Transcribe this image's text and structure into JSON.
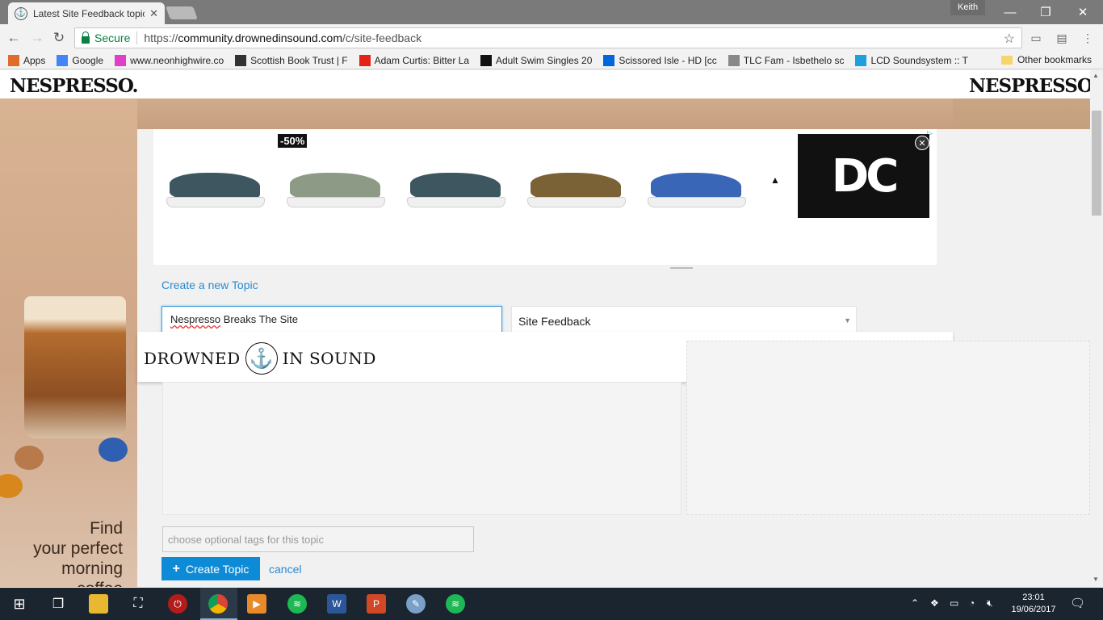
{
  "browser": {
    "tab_title": "Latest Site Feedback topics",
    "profile": "Keith",
    "secure_label": "Secure",
    "url_scheme": "https://",
    "url_host": "community.drownedinsound.com",
    "url_path": "/c/site-feedback"
  },
  "bookmarks": [
    {
      "label": "Apps",
      "icon": "apps-grid-icon",
      "color": "#e06b2b"
    },
    {
      "label": "Google",
      "icon": "google-icon",
      "color": "#4285f4"
    },
    {
      "label": "www.neonhighwire.co",
      "icon": "neonhighwire-icon",
      "color": "#e040c8"
    },
    {
      "label": "Scottish Book Trust | F",
      "icon": "book-trust-icon",
      "color": "#333333"
    },
    {
      "label": "Adam Curtis: Bitter La",
      "icon": "youtube-icon",
      "color": "#e62117"
    },
    {
      "label": "Adult Swim Singles 20",
      "icon": "adult-swim-icon",
      "color": "#111111"
    },
    {
      "label": "Scissored Isle - HD [cc",
      "icon": "dailymotion-icon",
      "color": "#0066dc"
    },
    {
      "label": "TLC Fam - Isbethelo sc",
      "icon": "tlc-icon",
      "color": "#888888"
    },
    {
      "label": "LCD Soundsystem :: T",
      "icon": "tm-icon",
      "color": "#1ea0dc"
    }
  ],
  "other_bookmarks": "Other bookmarks",
  "ad": {
    "brand_left": "NESPRESSO.",
    "brand_right": "NESPRESSO.",
    "tagline": [
      "Find",
      "your perfect",
      "morning",
      "coffee"
    ],
    "discount": "-50%",
    "shoe_colors": [
      "#3d5660",
      "#8d9a86",
      "#3d5660",
      "#7a6236",
      "#3a66b8"
    ],
    "dc_logo": "DC"
  },
  "composer": {
    "heading": "Create a new Topic",
    "title_value_word1": "Nespresso",
    "title_value_rest": " Breaks The Site",
    "category": "Site Feedback",
    "tags_placeholder": "choose optional tags for this topic",
    "create_label": "Create Topic",
    "cancel_label": "cancel"
  },
  "site": {
    "logo_left": "DROWNED",
    "logo_right": "IN SOUND"
  },
  "clock": {
    "time": "23:01",
    "date": "19/06/2017"
  }
}
